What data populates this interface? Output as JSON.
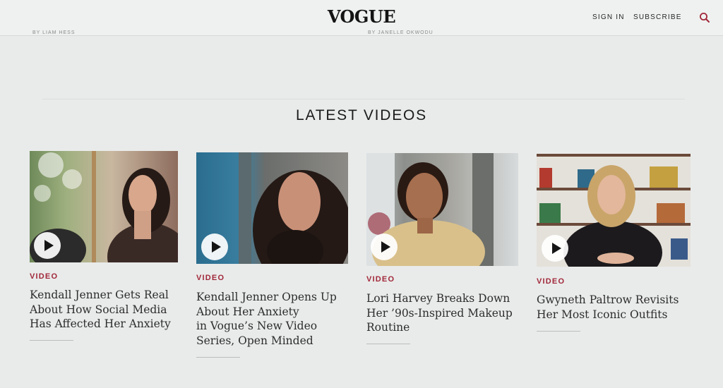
{
  "header": {
    "logo": "VOGUE",
    "sign_in": "SIGN IN",
    "subscribe": "SUBSCRIBE",
    "search_icon": "search-icon"
  },
  "bylines": {
    "left": "BY LIAM HESS",
    "right": "BY JANELLE OKWODU"
  },
  "section": {
    "title": "LATEST VIDEOS"
  },
  "videos": [
    {
      "label": "VIDEO",
      "headline": "Kendall Jenner Gets Real\nAbout How Social Media\nHas Affected Her Anxiety"
    },
    {
      "label": "VIDEO",
      "headline": "Kendall Jenner Opens Up\nAbout Her Anxiety\nin Vogue’s New Video\nSeries, Open Minded"
    },
    {
      "label": "VIDEO",
      "headline": "Lori Harvey Breaks Down\nHer ’90s-Inspired Makeup\nRoutine"
    },
    {
      "label": "VIDEO",
      "headline": "Gwyneth Paltrow Revisits\nHer Most Iconic Outfits"
    }
  ],
  "colors": {
    "accent": "#a1273a",
    "background": "#e9ebea"
  }
}
